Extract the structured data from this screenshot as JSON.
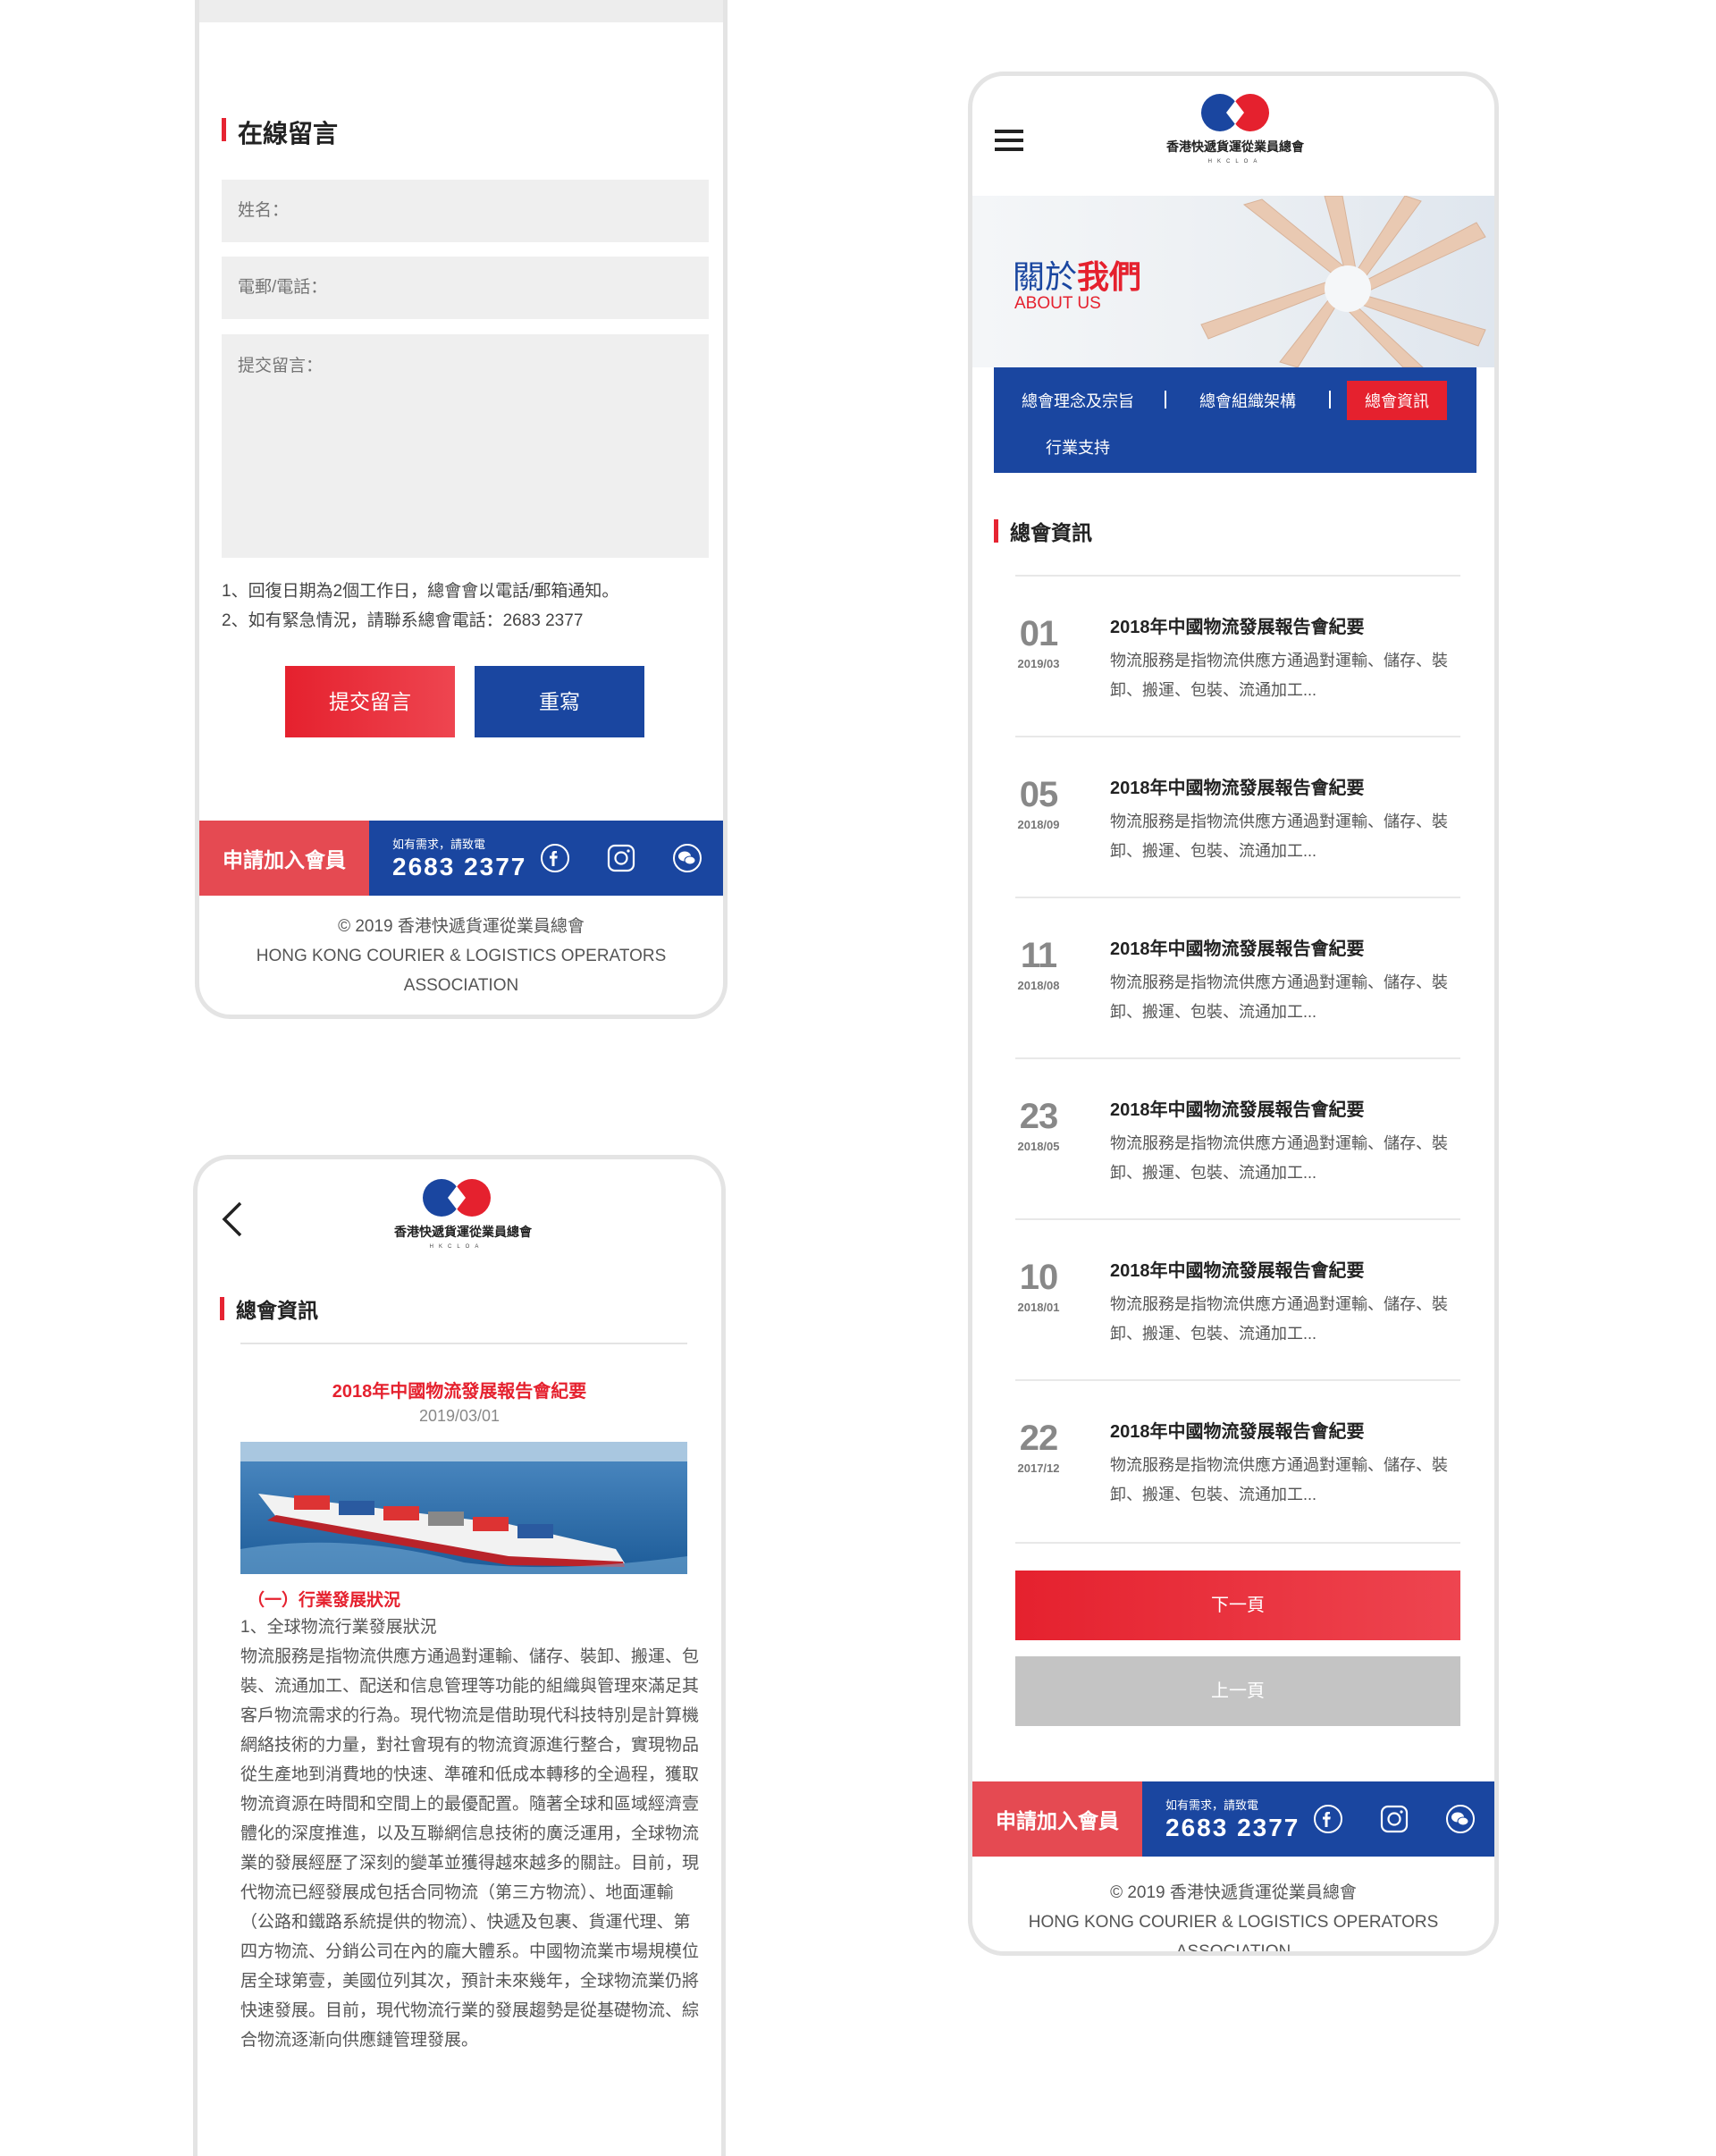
{
  "colors": {
    "red": "#e5212e",
    "blue": "#1a46a0",
    "gray_button": "#c4c4c4"
  },
  "org": {
    "name": "香港快遞貨運從業員總會",
    "abbr": "HKCLOA"
  },
  "form": {
    "title": "在線留言",
    "name_placeholder": "姓名：",
    "contact_placeholder": "電郵/電話：",
    "message_placeholder": "提交留言：",
    "notes": [
      "1、回復日期為2個工作日，總會會以電話/郵箱通知。",
      "2、如有緊急情況，請聯系總會電話：2683 2377"
    ],
    "submit_label": "提交留言",
    "reset_label": "重寫"
  },
  "footer": {
    "join_label": "申請加入會員",
    "contact_small": "如有需求，請致電",
    "phone": "2683  2377",
    "social_icons": [
      "facebook-icon",
      "instagram-icon",
      "wechat-icon"
    ],
    "copyright_line1": "© 2019 香港快遞貨運從業員總會",
    "copyright_line2": "HONG KONG COURIER & LOGISTICS OPERATORS ASSOCIATION"
  },
  "article": {
    "section_title": "總會資訊",
    "title": "2018年中國物流發展報告會紀要",
    "date": "2019/03/01",
    "subheading": "（一）行業發展狀況",
    "point1": "1、全球物流行業發展狀況",
    "paragraph": "物流服務是指物流供應方通過對運輸、儲存、裝卸、搬運、包裝、流通加工、配送和信息管理等功能的組織與管理來滿足其客戶物流需求的行為。現代物流是借助現代科技特別是計算機網絡技術的力量，對社會現有的物流資源進行整合，實現物品從生產地到消費地的快速、準確和低成本轉移的全過程，獲取物流資源在時間和空間上的最優配置。隨著全球和區域經濟壹體化的深度推進，以及互聯網信息技術的廣泛運用，全球物流業的發展經歷了深刻的變革並獲得越來越多的關註。目前，現代物流已經發展成包括合同物流（第三方物流）、地面運輸（公路和鐵路系統提供的物流）、快遞及包裹、貨運代理、第四方物流、分銷公司在內的龐大體系。中國物流業市場規模位居全球第壹，美國位列其次，預計未來幾年，全球物流業仍將快速發展。目前，現代物流行業的發展趨勢是從基礎物流、綜合物流逐漸向供應鏈管理發展。"
  },
  "about": {
    "title_normal": "關於",
    "title_bold": "我們",
    "title_en": "ABOUT US",
    "tabs": [
      "總會理念及宗旨",
      "總會組織架構",
      "總會資訊",
      "行業支持"
    ],
    "active_tab": "總會資訊"
  },
  "news": {
    "section_title": "總會資訊",
    "items": [
      {
        "day": "01",
        "date": "2019/03",
        "title": "2018年中國物流發展報告會紀要",
        "desc": "物流服務是指物流供應方通過對運輸、儲存、裝卸、搬運、包裝、流通加工..."
      },
      {
        "day": "05",
        "date": "2018/09",
        "title": "2018年中國物流發展報告會紀要",
        "desc": "物流服務是指物流供應方通過對運輸、儲存、裝卸、搬運、包裝、流通加工..."
      },
      {
        "day": "11",
        "date": "2018/08",
        "title": "2018年中國物流發展報告會紀要",
        "desc": "物流服務是指物流供應方通過對運輸、儲存、裝卸、搬運、包裝、流通加工..."
      },
      {
        "day": "23",
        "date": "2018/05",
        "title": "2018年中國物流發展報告會紀要",
        "desc": "物流服務是指物流供應方通過對運輸、儲存、裝卸、搬運、包裝、流通加工..."
      },
      {
        "day": "10",
        "date": "2018/01",
        "title": "2018年中國物流發展報告會紀要",
        "desc": "物流服務是指物流供應方通過對運輸、儲存、裝卸、搬運、包裝、流通加工..."
      },
      {
        "day": "22",
        "date": "2017/12",
        "title": "2018年中國物流發展報告會紀要",
        "desc": "物流服務是指物流供應方通過對運輸、儲存、裝卸、搬運、包裝、流通加工..."
      }
    ],
    "next_label": "下一頁",
    "prev_label": "上一頁"
  }
}
